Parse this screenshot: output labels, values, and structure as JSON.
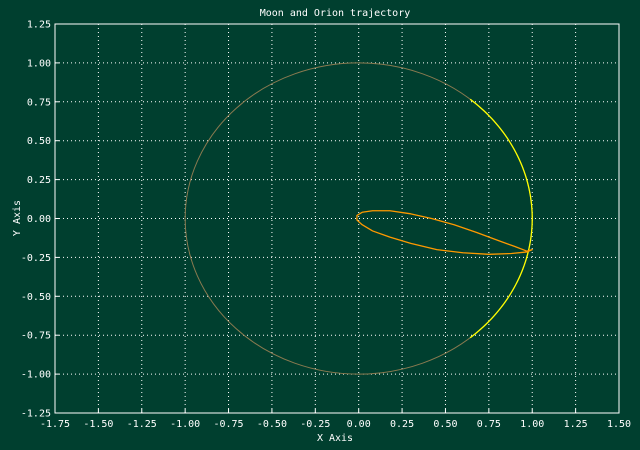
{
  "chart_data": {
    "type": "line",
    "title": "Moon and Orion trajectory",
    "xlabel": "X Axis",
    "ylabel": "Y Axis",
    "xlim": [
      -1.75,
      1.5
    ],
    "ylim": [
      -1.25,
      1.25
    ],
    "x_ticks": [
      "-1.75",
      "-1.50",
      "-1.25",
      "-1.00",
      "-0.75",
      "-0.50",
      "-0.25",
      "0.00",
      "0.25",
      "0.50",
      "0.75",
      "1.00",
      "1.25",
      "1.50"
    ],
    "y_ticks": [
      "1.25",
      "1.00",
      "0.75",
      "0.50",
      "0.25",
      "0.00",
      "-0.25",
      "-0.50",
      "-0.75",
      "-1.00",
      "-1.25"
    ],
    "grid": true,
    "series": [
      {
        "kind": "moon-orbit",
        "shape": "circle",
        "center": [
          0.0,
          0.0
        ],
        "radius": 1.0,
        "color": "#8a7a50"
      },
      {
        "kind": "moon-arc",
        "shape": "arc",
        "center": [
          0.0,
          0.0
        ],
        "radius": 1.0,
        "angle_from_deg": -50,
        "angle_to_deg": 50,
        "color": "#ffff00"
      },
      {
        "kind": "orion-trajectory",
        "shape": "path",
        "color": "#ff9900",
        "points": [
          [
            0.97,
            -0.21
          ],
          [
            0.9,
            -0.18
          ],
          [
            0.8,
            -0.14
          ],
          [
            0.68,
            -0.09
          ],
          [
            0.55,
            -0.04
          ],
          [
            0.42,
            0.0
          ],
          [
            0.3,
            0.03
          ],
          [
            0.18,
            0.05
          ],
          [
            0.08,
            0.05
          ],
          [
            0.02,
            0.04
          ],
          [
            -0.01,
            0.02
          ],
          [
            -0.01,
            -0.01
          ],
          [
            0.02,
            -0.04
          ],
          [
            0.08,
            -0.08
          ],
          [
            0.18,
            -0.12
          ],
          [
            0.3,
            -0.16
          ],
          [
            0.45,
            -0.2
          ],
          [
            0.6,
            -0.22
          ],
          [
            0.75,
            -0.23
          ],
          [
            0.88,
            -0.225
          ],
          [
            0.97,
            -0.215
          ],
          [
            1.0,
            -0.2
          ],
          [
            0.97,
            -0.21
          ]
        ]
      }
    ]
  },
  "colors": {
    "background": "#003f2f",
    "axis": "#ffffff",
    "grid": "#ffffff",
    "text": "#ffffff"
  }
}
